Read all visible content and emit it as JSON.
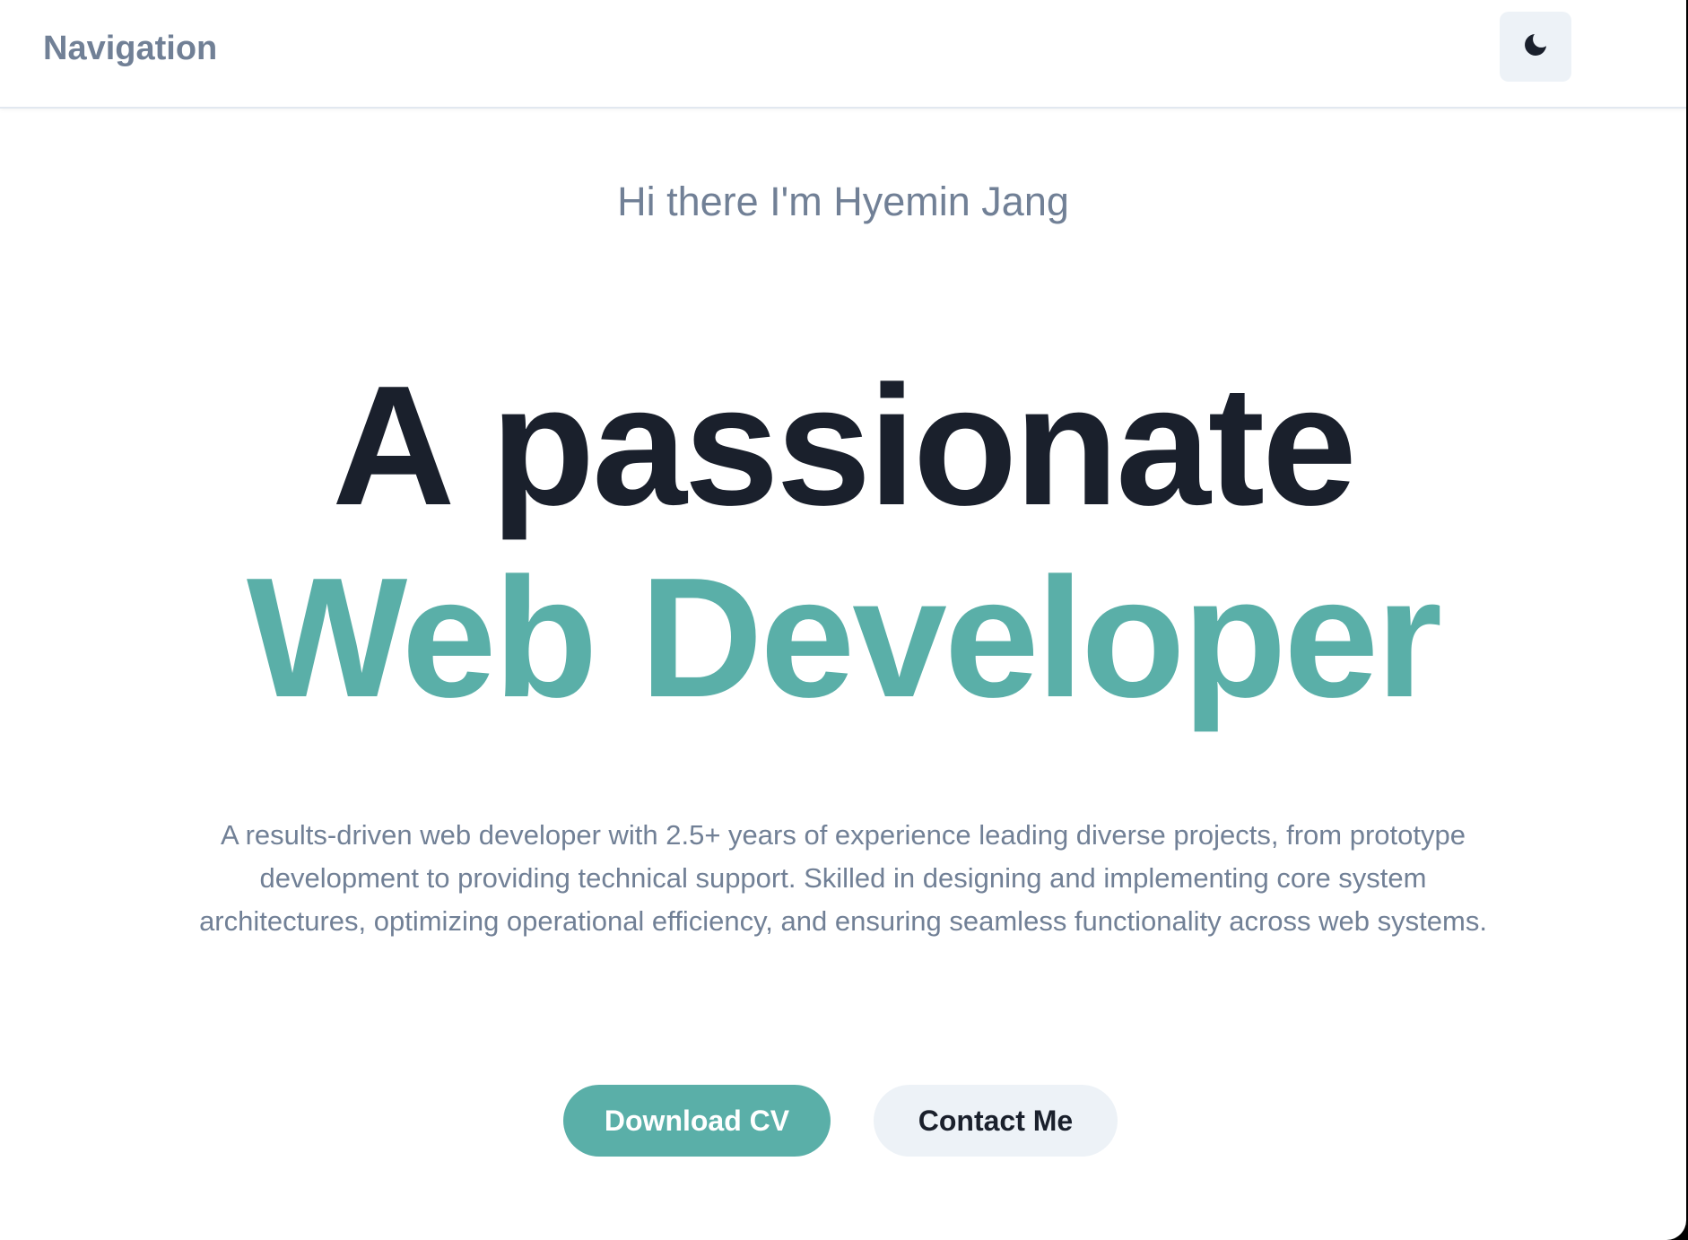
{
  "nav": {
    "brand": "Navigation",
    "theme_toggle_icon": "moon-icon"
  },
  "hero": {
    "greeting": "Hi there I'm Hyemin Jang",
    "headline": "A passionate",
    "headline_accent": "Web Developer",
    "description": "A results-driven web developer with 2.5+ years of experience leading diverse projects, from prototype development to providing technical support. Skilled in designing and implementing core system architectures, optimizing operational efficiency, and ensuring seamless functionality across web systems.",
    "primary_button": "Download CV",
    "secondary_button": "Contact Me"
  },
  "colors": {
    "accent": "#5aafa8",
    "heading": "#1a202c",
    "muted": "#718096",
    "button_secondary_bg": "#edf2f7"
  }
}
